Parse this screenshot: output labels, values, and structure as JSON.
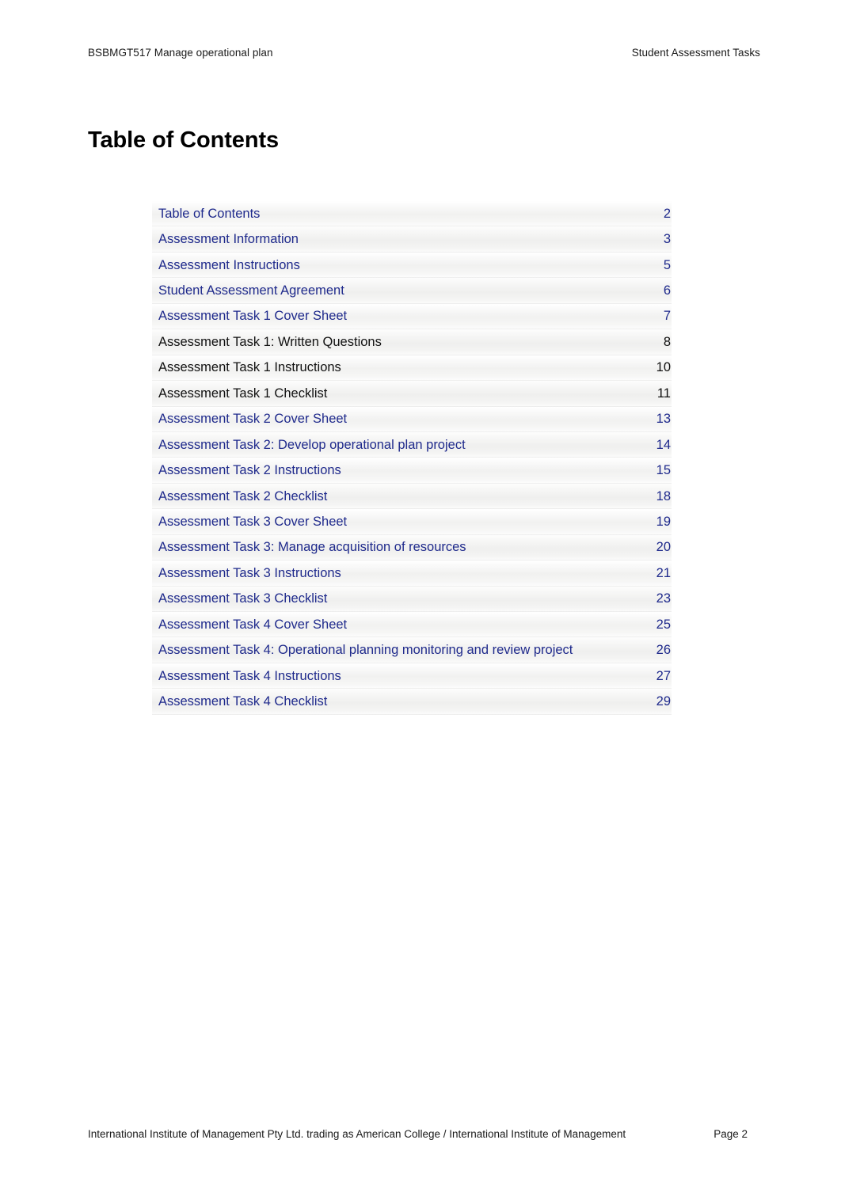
{
  "header": {
    "left": "BSBMGT517 Manage operational plan",
    "right": "Student Assessment Tasks"
  },
  "title": "Table of Contents",
  "colors": {
    "link": "#1f2a8c",
    "plain": "#111111",
    "page_background": "#ffffff"
  },
  "toc": {
    "entries": [
      {
        "label": "Table of Contents",
        "page": "2",
        "style": "link"
      },
      {
        "label": "Assessment Information",
        "page": "3",
        "style": "link"
      },
      {
        "label": "Assessment Instructions",
        "page": "5",
        "style": "link"
      },
      {
        "label": "Student Assessment Agreement",
        "page": "6",
        "style": "link"
      },
      {
        "label": "Assessment Task 1 Cover Sheet",
        "page": "7",
        "style": "link"
      },
      {
        "label": "Assessment Task 1: Written Questions",
        "page": "8",
        "style": "plain"
      },
      {
        "label": "Assessment Task 1 Instructions",
        "page": "10",
        "style": "plain"
      },
      {
        "label": "Assessment Task 1 Checklist",
        "page": "11",
        "style": "plain"
      },
      {
        "label": "Assessment Task 2 Cover Sheet",
        "page": "13",
        "style": "link"
      },
      {
        "label": "Assessment Task 2: Develop operational plan project",
        "page": "14",
        "style": "link"
      },
      {
        "label": "Assessment Task 2 Instructions",
        "page": "15",
        "style": "link"
      },
      {
        "label": "Assessment Task 2 Checklist",
        "page": "18",
        "style": "link"
      },
      {
        "label": "Assessment Task 3 Cover Sheet",
        "page": "19",
        "style": "link"
      },
      {
        "label": "Assessment Task 3: Manage acquisition of resources",
        "page": "20",
        "style": "link"
      },
      {
        "label": "Assessment Task 3 Instructions",
        "page": "21",
        "style": "link"
      },
      {
        "label": "Assessment Task 3 Checklist",
        "page": "23",
        "style": "link"
      },
      {
        "label": "Assessment Task 4 Cover Sheet",
        "page": "25",
        "style": "link"
      },
      {
        "label": "Assessment Task 4: Operational planning monitoring and review project",
        "page": "26",
        "style": "link"
      },
      {
        "label": "Assessment Task 4 Instructions",
        "page": "27",
        "style": "link"
      },
      {
        "label": "Assessment Task 4 Checklist",
        "page": "29",
        "style": "link"
      }
    ]
  },
  "footer": {
    "left": "International Institute of Management Pty Ltd. trading as American College / International Institute of Management",
    "right": "Page 2"
  }
}
